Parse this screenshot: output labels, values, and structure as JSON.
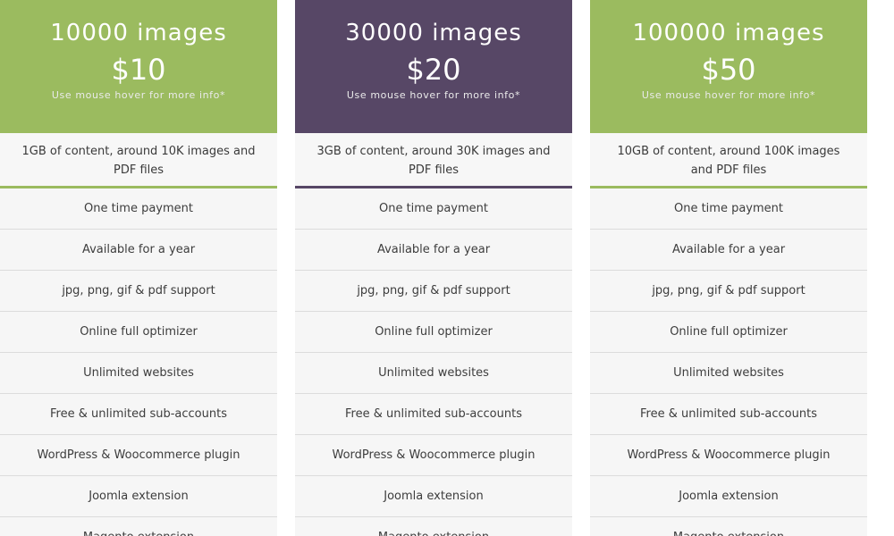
{
  "plans": [
    {
      "title": "10000 images",
      "price": "$10",
      "hint": "Use mouse hover for more info*",
      "description": "1GB of content, around 10K images and PDF files",
      "header_color": "#9bbb5f",
      "features": [
        "One time payment",
        "Available for a year",
        "jpg, png, gif & pdf support",
        "Online full optimizer",
        "Unlimited websites",
        "Free & unlimited sub-accounts",
        "WordPress & Woocommerce plugin",
        "Joomla extension",
        "Magento extension"
      ]
    },
    {
      "title": "30000 images",
      "price": "$20",
      "hint": "Use mouse hover for more info*",
      "description": "3GB of content, around 30K images and PDF files",
      "header_color": "#574766",
      "features": [
        "One time payment",
        "Available for a year",
        "jpg, png, gif & pdf support",
        "Online full optimizer",
        "Unlimited websites",
        "Free & unlimited sub-accounts",
        "WordPress & Woocommerce plugin",
        "Joomla extension",
        "Magento extension"
      ]
    },
    {
      "title": "100000 images",
      "price": "$50",
      "hint": "Use mouse hover for more info*",
      "description": "10GB of content, around 100K images and PDF files",
      "header_color": "#9bbb5f",
      "features": [
        "One time payment",
        "Available for a year",
        "jpg, png, gif & pdf support",
        "Online full optimizer",
        "Unlimited websites",
        "Free & unlimited sub-accounts",
        "WordPress & Woocommerce plugin",
        "Joomla extension",
        "Magento extension"
      ]
    }
  ]
}
